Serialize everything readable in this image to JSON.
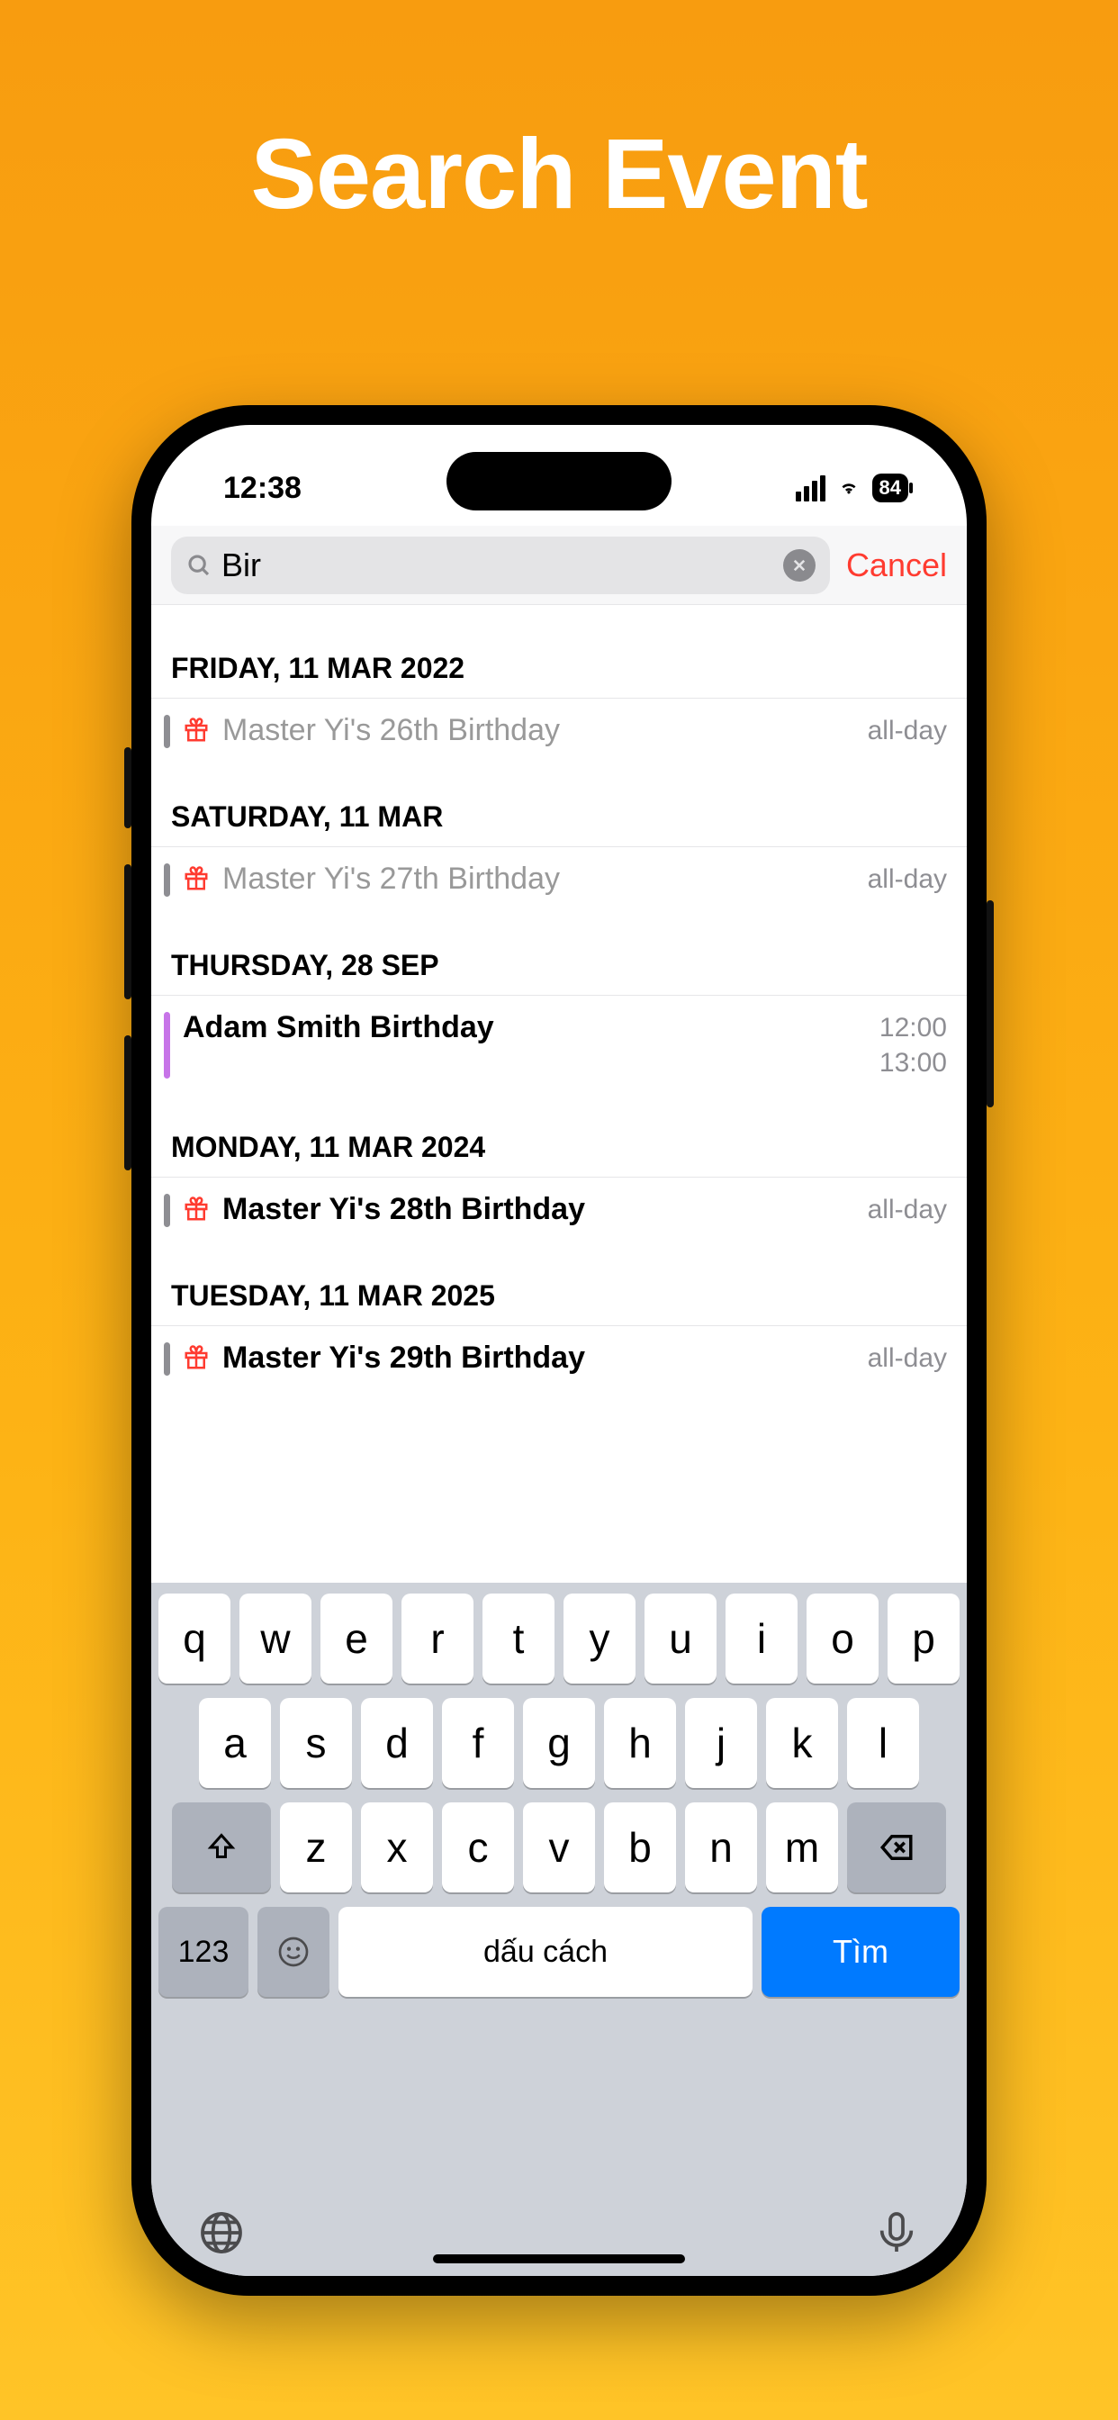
{
  "promo": {
    "title": "Search Event"
  },
  "status": {
    "time": "12:38",
    "battery": "84"
  },
  "search": {
    "query": "Bir",
    "cancel": "Cancel"
  },
  "results": [
    {
      "date": "FRIDAY, 11 MAR 2022",
      "events": [
        {
          "title": "Master Yi's 26th Birthday",
          "time1": "all-day",
          "time2": "",
          "muted": true,
          "gift": true,
          "bar": "gray"
        }
      ]
    },
    {
      "date": "SATURDAY, 11 MAR",
      "events": [
        {
          "title": "Master Yi's 27th Birthday",
          "time1": "all-day",
          "time2": "",
          "muted": true,
          "gift": true,
          "bar": "gray"
        }
      ]
    },
    {
      "date": "THURSDAY, 28 SEP",
      "events": [
        {
          "title": "Adam Smith Birthday",
          "time1": "12:00",
          "time2": "13:00",
          "muted": false,
          "gift": false,
          "bar": "purple"
        }
      ]
    },
    {
      "date": "MONDAY, 11 MAR 2024",
      "events": [
        {
          "title": "Master Yi's 28th Birthday",
          "time1": "all-day",
          "time2": "",
          "muted": false,
          "gift": true,
          "bar": "gray"
        }
      ]
    },
    {
      "date": "TUESDAY, 11 MAR 2025",
      "events": [
        {
          "title": "Master Yi's 29th Birthday",
          "time1": "all-day",
          "time2": "",
          "muted": false,
          "gift": true,
          "bar": "gray"
        }
      ]
    }
  ],
  "keyboard": {
    "row1": [
      "q",
      "w",
      "e",
      "r",
      "t",
      "y",
      "u",
      "i",
      "o",
      "p"
    ],
    "row2": [
      "a",
      "s",
      "d",
      "f",
      "g",
      "h",
      "j",
      "k",
      "l"
    ],
    "row3": [
      "z",
      "x",
      "c",
      "v",
      "b",
      "n",
      "m"
    ],
    "k123": "123",
    "space": "dấu cách",
    "search": "Tìm"
  }
}
